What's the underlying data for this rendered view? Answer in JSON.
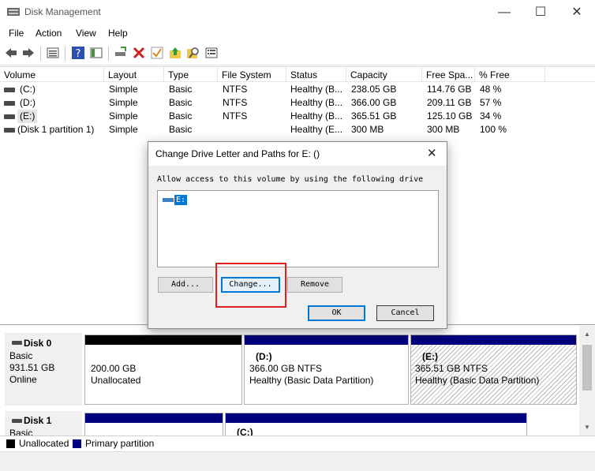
{
  "window": {
    "title": "Disk Management",
    "minimize": "—",
    "maximize": "☐",
    "close": "✕"
  },
  "menu": [
    "File",
    "Action",
    "View",
    "Help"
  ],
  "toolbar_icons": [
    "back-arrow-icon",
    "forward-arrow-icon",
    "properties-list-icon",
    "help-icon",
    "console-pane-icon",
    "connect-drive-icon",
    "delete-icon",
    "check-icon",
    "up-folder-icon",
    "search-icon",
    "settings-list-icon"
  ],
  "volumes": {
    "columns": [
      "Volume",
      "Layout",
      "Type",
      "File System",
      "Status",
      "Capacity",
      "Free Spa...",
      "% Free"
    ],
    "rows": [
      {
        "volume": "(C:)",
        "layout": "Simple",
        "type": "Basic",
        "fs": "NTFS",
        "status": "Healthy (B...",
        "capacity": "238.05 GB",
        "free": "114.76 GB",
        "pct": "48 %"
      },
      {
        "volume": "(D:)",
        "layout": "Simple",
        "type": "Basic",
        "fs": "NTFS",
        "status": "Healthy (B...",
        "capacity": "366.00 GB",
        "free": "209.11 GB",
        "pct": "57 %"
      },
      {
        "volume": "(E:)",
        "layout": "Simple",
        "type": "Basic",
        "fs": "NTFS",
        "status": "Healthy (B...",
        "capacity": "365.51 GB",
        "free": "125.10 GB",
        "pct": "34 %"
      },
      {
        "volume": "(Disk 1 partition 1)",
        "layout": "Simple",
        "type": "Basic",
        "fs": "",
        "status": "Healthy (E...",
        "capacity": "300 MB",
        "free": "300 MB",
        "pct": "100 %"
      }
    ]
  },
  "disks": [
    {
      "name": "Disk 0",
      "type": "Basic",
      "size": "931.51 GB",
      "state": "Online",
      "partitions": [
        {
          "letter": "",
          "size": "200.00 GB",
          "detail": "Unallocated"
        },
        {
          "letter": "(D:)",
          "size": "366.00 GB NTFS",
          "detail": "Healthy (Basic Data Partition)"
        },
        {
          "letter": "(E:)",
          "size": "365.51 GB NTFS",
          "detail": "Healthy (Basic Data Partition)"
        }
      ]
    },
    {
      "name": "Disk 1",
      "type": "Basic",
      "partitions": [
        {
          "letter": "(C:)"
        }
      ]
    }
  ],
  "legend": {
    "unallocated": "Unallocated",
    "primary": "Primary partition",
    "unallocated_color": "#000000",
    "primary_color": "#00007c"
  },
  "dialog": {
    "title": "Change Drive Letter and Paths for E: ()",
    "instruction": "Allow access to this volume by using the following drive",
    "list_item": "E:",
    "add": "Add...",
    "change": "Change...",
    "remove": "Remove",
    "ok": "OK",
    "cancel": "Cancel",
    "highlight_color": "#e02020"
  }
}
